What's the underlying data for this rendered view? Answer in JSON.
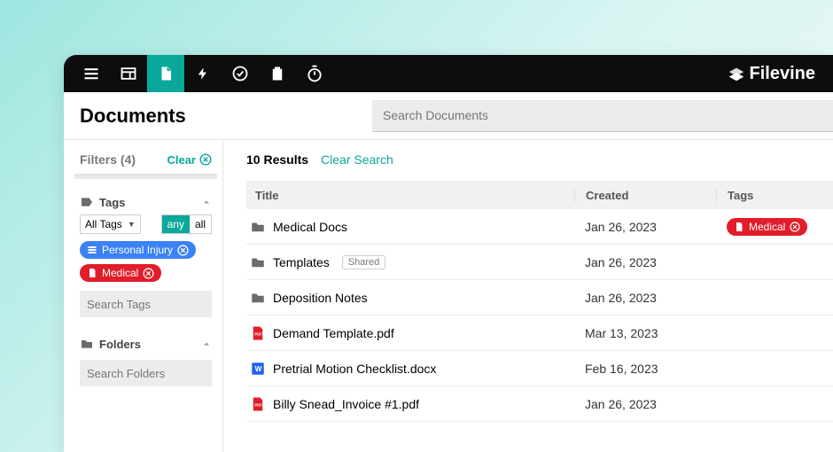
{
  "brand": "Filevine",
  "page_title": "Documents",
  "search": {
    "placeholder": "Search Documents"
  },
  "sidebar": {
    "filters_label": "Filters (4)",
    "clear_label": "Clear",
    "tags_section": "Tags",
    "tags_select": "All Tags",
    "any_label": "any",
    "all_label": "all",
    "applied_tags": [
      {
        "label": "Personal Injury",
        "color": "blue",
        "icon": "org"
      },
      {
        "label": "Medical",
        "color": "red",
        "icon": "doc"
      }
    ],
    "search_tags_placeholder": "Search Tags",
    "folders_section": "Folders",
    "search_folders_placeholder": "Search Folders"
  },
  "results": {
    "count_label": "10 Results",
    "clear_search_label": "Clear Search",
    "columns": {
      "title": "Title",
      "created": "Created",
      "tags": "Tags"
    },
    "rows": [
      {
        "icon": "folder",
        "name": "Medical Docs",
        "created": "Jan 26, 2023",
        "tag": {
          "label": "Medical",
          "color": "red"
        },
        "badge": null
      },
      {
        "icon": "folder",
        "name": "Templates",
        "created": "Jan 26, 2023",
        "tag": null,
        "badge": "Shared"
      },
      {
        "icon": "folder",
        "name": "Deposition Notes",
        "created": "Jan 26, 2023",
        "tag": null,
        "badge": null
      },
      {
        "icon": "pdf",
        "name": "Demand Template.pdf",
        "created": "Mar 13, 2023",
        "tag": null,
        "badge": null
      },
      {
        "icon": "docx",
        "name": "Pretrial Motion Checklist.docx",
        "created": "Feb 16, 2023",
        "tag": null,
        "badge": null
      },
      {
        "icon": "pdf",
        "name": "Billy Snead_Invoice #1.pdf",
        "created": "Jan 26, 2023",
        "tag": null,
        "badge": null
      }
    ]
  }
}
